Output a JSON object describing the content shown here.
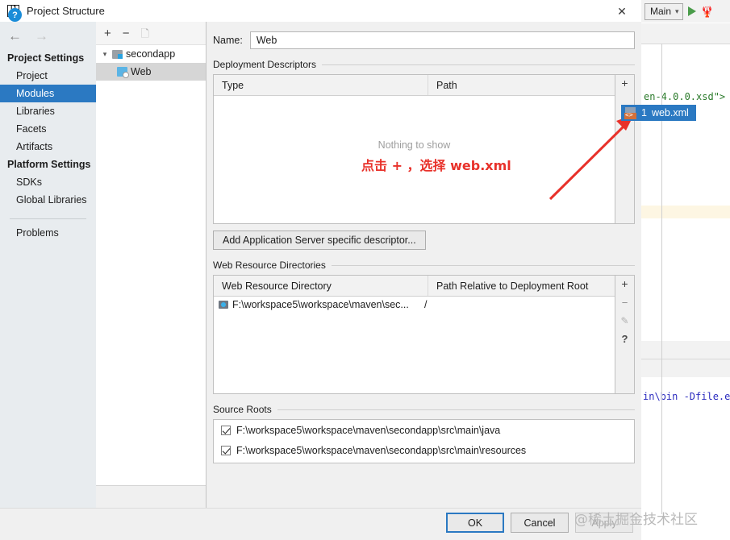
{
  "window": {
    "title": "Project Structure",
    "logo_icon": "intellij-idea-logo",
    "close_icon": "close-icon"
  },
  "nav": {
    "back_icon": "arrow-left-icon",
    "forward_icon": "arrow-right-icon",
    "groups": [
      {
        "title": "Project Settings",
        "items": [
          "Project",
          "Modules",
          "Libraries",
          "Facets",
          "Artifacts"
        ]
      },
      {
        "title": "Platform Settings",
        "items": [
          "SDKs",
          "Global Libraries"
        ]
      }
    ],
    "selected": "Modules",
    "problems": "Problems"
  },
  "tree": {
    "toolbar": {
      "add": "+",
      "remove": "−",
      "copy_icon": "copy-icon"
    },
    "root": {
      "label": "secondapp",
      "expand_icon": "chevron-down-icon",
      "folder_icon": "module-folder-icon"
    },
    "child": {
      "label": "Web",
      "icon": "web-facet-icon",
      "selected": true
    }
  },
  "main": {
    "name_label": "Name:",
    "name_value": "Web",
    "deployment": {
      "title": "Deployment Descriptors",
      "columns": [
        "Type",
        "Path"
      ],
      "rows": [],
      "empty_text": "Nothing to show",
      "buttons": {
        "add": "+",
        "edit_icon": "pencil-icon"
      }
    },
    "add_descriptor_button": "Add Application Server specific descriptor...",
    "web_resources": {
      "title": "Web Resource Directories",
      "columns": [
        "Web Resource Directory",
        "Path Relative to Deployment Root"
      ],
      "rows": [
        {
          "icon": "directory-icon",
          "directory": "F:\\workspace5\\workspace\\maven\\sec...",
          "relative_path": "/"
        }
      ],
      "buttons": {
        "add": "+",
        "remove": "−",
        "edit_icon": "pencil-icon",
        "help": "?"
      }
    },
    "source_roots": {
      "title": "Source Roots",
      "rows": [
        {
          "checked": true,
          "path": "F:\\workspace5\\workspace\\maven\\secondapp\\src\\main\\java"
        },
        {
          "checked": true,
          "path": "F:\\workspace5\\workspace\\maven\\secondapp\\src\\main\\resources"
        }
      ]
    }
  },
  "footer": {
    "help_icon": "help-icon",
    "ok": "OK",
    "cancel": "Cancel",
    "apply": "Apply"
  },
  "overlay": {
    "annotation_text": "点击 + ，选择 web.xml",
    "annotation_color": "#e8312a",
    "arrow_icon": "red-arrow-icon",
    "popup": {
      "index": "1",
      "label": "web.xml",
      "icon": "xml-file-icon"
    },
    "watermark": "@稀土掘金技术社区"
  },
  "ide_background": {
    "run_config": "Main",
    "run_caret_icon": "chevron-down-icon",
    "run_icon": "run-icon",
    "debug_icon": "debug-icon",
    "code_fragment_1": "en-4.0.0.xsd\">",
    "code_fragment_2": "in\\bin -Dfile.e"
  },
  "colors": {
    "accent": "#2b79c2",
    "annotation_red": "#e8312a",
    "dialog_bg": "#f0f0f0",
    "nav_bg": "#e8ecef"
  }
}
